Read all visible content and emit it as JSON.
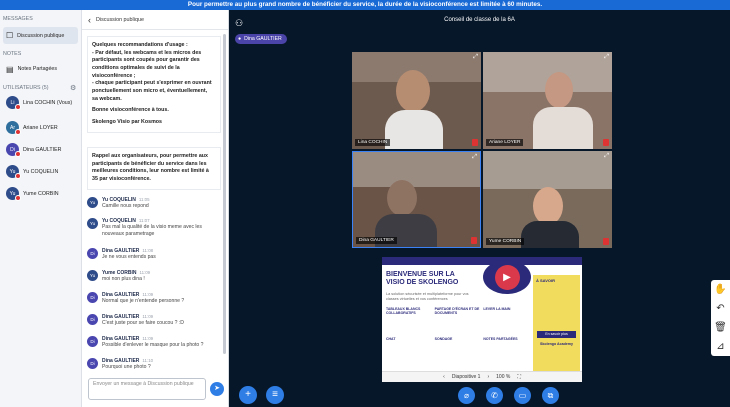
{
  "banner": "Pour permettre au plus grand nombre de bénéficier du service, la durée de la visioconférence est limitée à 60 minutes.",
  "left": {
    "messages_h": "MESSAGES",
    "public_chat": "Discussion publique",
    "notes_h": "NOTES",
    "shared_notes": "Notes Partagées",
    "users_h": "UTILISATEURS (5)",
    "users": [
      {
        "ini": "Li",
        "name": "Lina COCHIN (Vous)"
      },
      {
        "ini": "Ar",
        "name": "Ariane LOYER"
      },
      {
        "ini": "Di",
        "name": "Dina GAULTIER"
      },
      {
        "ini": "Yu",
        "name": "Yu COQUELIN"
      },
      {
        "ini": "Yu",
        "name": "Yume CORBIN"
      }
    ]
  },
  "chat": {
    "back": "‹",
    "title": "Discussion publique",
    "box1": [
      "Quelques recommandations d'usage :",
      "- Par défaut, les webcams et les micros des",
      "participants sont coupés pour garantir des",
      "conditions optimales de suivi de la",
      "visioconférence ;",
      "- chaque participant peut s'exprimer en ouvrant",
      "ponctuellement son micro et, éventuellement,",
      "sa webcam.",
      "",
      "Bonne visioconférence à tous.",
      "",
      "Skolengo Visio par Kosmos"
    ],
    "box2": [
      "Rappel aux organisateurs, pour permettre aux",
      "participants de bénéficier du service dans les",
      "meilleures conditions, leur nombre est limité à",
      "35 par visioconférence."
    ],
    "messages": [
      {
        "ini": "Yu",
        "name": "Yu COQUELIN",
        "time": "11:05",
        "lines": [
          "Camille nous repond"
        ]
      },
      {
        "ini": "Yu",
        "name": "Yu COQUELIN",
        "time": "11:07",
        "lines": [
          "Pas mal la qualité de la visio meme avec les",
          "nouveaux parametrage"
        ]
      },
      {
        "ini": "Di",
        "name": "Dina GAULTIER",
        "time": "11:08",
        "lines": [
          "Je ne vous entends pas"
        ]
      },
      {
        "ini": "Yu",
        "name": "Yume CORBIN",
        "time": "11:09",
        "lines": [
          "moi non plus dina !"
        ]
      },
      {
        "ini": "Di",
        "name": "Dina GAULTIER",
        "time": "11:09",
        "lines": [
          "Normal que je n'entende personne ?"
        ]
      },
      {
        "ini": "Di",
        "name": "Dina GAULTIER",
        "time": "11:09",
        "lines": [
          "C'est juste pour se faire coucou ? :D"
        ]
      },
      {
        "ini": "Di",
        "name": "Dina GAULTIER",
        "time": "11:09",
        "lines": [
          "Possible d'enlever le masque pour la photo ?"
        ]
      },
      {
        "ini": "Di",
        "name": "Dina GAULTIER",
        "time": "11:10",
        "lines": [
          "Pourquoi une photo ?"
        ]
      }
    ],
    "input_placeholder": "Envoyer un message à Discussion publique",
    "send": "➤"
  },
  "main": {
    "title": "Conseil de classe de la 6A",
    "presenter": "Dina GAULTIER",
    "tiles": [
      {
        "name": "Lina COCHIN"
      },
      {
        "name": "Ariane LOYER"
      },
      {
        "name": "Dina GAULTIER"
      },
      {
        "name": "Yume CORBIN"
      }
    ],
    "slide": {
      "heading1": "BIENVENUE SUR LA",
      "heading2": "VISIO DE SKOLENGO",
      "sub": "La solution sécurisée et multiplateforme pour vos classes virtuelles et vos conférences",
      "features": [
        "TABLEAUX BLANCS COLLABORATIFS",
        "PARTAGE D'ÉCRAN ET DE DOCUMENTS",
        "LEVER LA MAIN",
        "CHAT",
        "SONDAGE",
        "NOTES PARTAGÉES"
      ],
      "side": "À SAVOIR",
      "side_btn": "En savoir plus",
      "brand": "Skolengo Academy",
      "ctrl_label": "Diapositive 1",
      "zoom": "100 %"
    }
  }
}
